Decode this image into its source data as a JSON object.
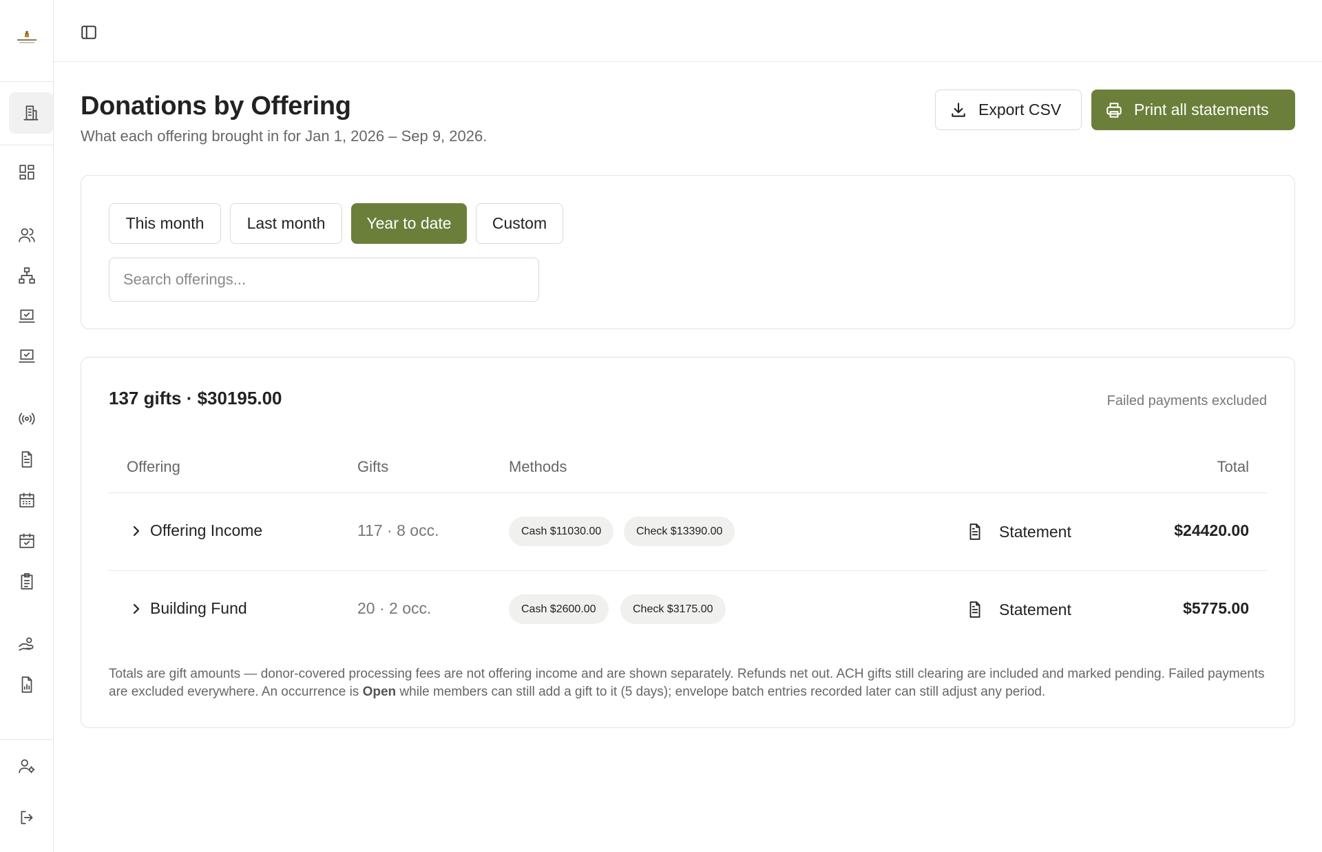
{
  "sidebar": {
    "logo": "church-logo",
    "items": [
      {
        "name": "sidebar-item-organization",
        "icon": "building-icon",
        "active": true
      },
      {
        "name": "sidebar-item-dashboard",
        "icon": "dashboard-grid-icon"
      },
      {
        "name": "sidebar-item-people",
        "icon": "users-icon"
      },
      {
        "name": "sidebar-item-groups",
        "icon": "hierarchy-icon"
      },
      {
        "name": "sidebar-item-checkins",
        "icon": "laptop-check-icon"
      },
      {
        "name": "sidebar-item-checkins-2",
        "icon": "laptop-check-icon"
      },
      {
        "name": "sidebar-item-broadcast",
        "icon": "broadcast-icon"
      },
      {
        "name": "sidebar-item-documents",
        "icon": "document-icon"
      },
      {
        "name": "sidebar-item-calendar",
        "icon": "calendar-icon"
      },
      {
        "name": "sidebar-item-events",
        "icon": "calendar-check-icon"
      },
      {
        "name": "sidebar-item-tasks",
        "icon": "clipboard-icon"
      },
      {
        "name": "sidebar-item-giving",
        "icon": "hand-coin-icon"
      },
      {
        "name": "sidebar-item-reports",
        "icon": "report-chart-icon"
      },
      {
        "name": "sidebar-item-account",
        "icon": "user-settings-icon"
      },
      {
        "name": "sidebar-item-logout",
        "icon": "logout-icon"
      }
    ]
  },
  "header": {
    "title": "Donations by Offering",
    "subtitle": "What each offering brought in for Jan 1, 2026 – Sep 9, 2026.",
    "export_label": "Export CSV",
    "print_label": "Print all statements"
  },
  "filters": {
    "ranges": [
      "This month",
      "Last month",
      "Year to date",
      "Custom"
    ],
    "active_range": "Year to date",
    "search_placeholder": "Search offerings..."
  },
  "summary": {
    "title": "137 gifts · $30195.00",
    "note": "Failed payments excluded",
    "columns": {
      "offering": "Offering",
      "gifts": "Gifts",
      "methods": "Methods",
      "total": "Total"
    },
    "rows": [
      {
        "name": "Offering Income",
        "gifts": "117 · 8 occ.",
        "methods": [
          "Cash $11030.00",
          "Check $13390.00"
        ],
        "statement_label": "Statement",
        "total": "$24420.00"
      },
      {
        "name": "Building Fund",
        "gifts": "20 · 2 occ.",
        "methods": [
          "Cash $2600.00",
          "Check $3175.00"
        ],
        "statement_label": "Statement",
        "total": "$5775.00"
      }
    ],
    "footnote": {
      "part1": "Totals are gift amounts — donor-covered processing fees are not offering income and are shown separately. Refunds net out. ACH gifts still clearing are included and marked pending. Failed payments are excluded everywhere. An occurrence is ",
      "bold": "Open",
      "part2": " while members can still add a gift to it (5 days); envelope batch entries recorded later can still adjust any period."
    }
  },
  "colors": {
    "accent": "#6b7f3a",
    "border": "#e3e3e3",
    "tag_bg": "#f0f0ef"
  }
}
